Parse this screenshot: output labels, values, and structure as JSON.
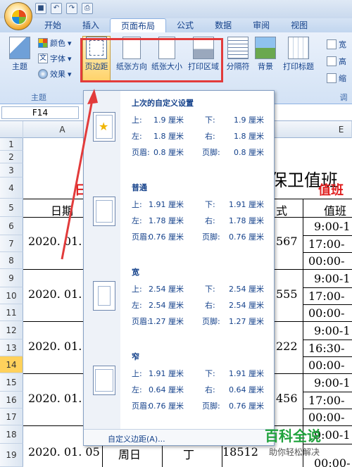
{
  "tabs": [
    "开始",
    "插入",
    "页面布局",
    "公式",
    "数据",
    "审阅",
    "视图"
  ],
  "ribbon": {
    "theme_group": {
      "label": "主题",
      "themes_button": "主题",
      "colors": "颜色",
      "fonts": "字体",
      "effects": "效果"
    },
    "page_setup_buttons": [
      "页边距",
      "纸张方向",
      "纸张大小",
      "打印区域",
      "分隔符",
      "背景",
      "打印标题"
    ],
    "right_items": [
      "宽",
      "高",
      "缩"
    ],
    "right_group_label": "调"
  },
  "formula_bar": {
    "name_box": "F14"
  },
  "columns": [
    "A",
    "E"
  ],
  "rows": [
    "1",
    "2",
    "3",
    "4",
    "5",
    "6",
    "7",
    "8",
    "9",
    "10",
    "11",
    "12",
    "13",
    "14",
    "15",
    "16",
    "17",
    "18",
    "19"
  ],
  "sheet": {
    "title_fragment": "全保卫值班",
    "header_left": "日",
    "header_right": "值班",
    "col_date": "日期",
    "col_shift": "值班",
    "col_partial": "式",
    "dates": [
      "2020. 01.",
      "2020. 01.",
      "2020. 01.",
      "2020. 01.",
      "2020. 01. 05"
    ],
    "phone_fragments": [
      "567",
      "555",
      "222",
      "456",
      "18512"
    ],
    "weekday_fragment": "周日",
    "name_fragment": "丁",
    "times": [
      "9:00-1",
      "17:00-",
      "00:00-",
      "9:00-1",
      "17:00-",
      "00:00-",
      "9:00-1",
      "16:30-",
      "00:00-",
      "9:00-1",
      "17:00-",
      "00:00-",
      "9:00-1",
      "00:00-"
    ]
  },
  "dropdown": {
    "presets": [
      {
        "name": "上次的自定义设置",
        "top": "1.9 厘米",
        "bottom": "1.9 厘米",
        "left": "1.8 厘米",
        "right": "1.8 厘米",
        "header": "0.8 厘米",
        "footer": "0.8 厘米"
      },
      {
        "name": "普通",
        "top": "1.91 厘米",
        "bottom": "1.91 厘米",
        "left": "1.78 厘米",
        "right": "1.78 厘米",
        "header": "0.76 厘米",
        "footer": "0.76 厘米"
      },
      {
        "name": "宽",
        "top": "2.54 厘米",
        "bottom": "2.54 厘米",
        "left": "2.54 厘米",
        "right": "2.54 厘米",
        "header": "1.27 厘米",
        "footer": "1.27 厘米"
      },
      {
        "name": "窄",
        "top": "1.91 厘米",
        "bottom": "1.91 厘米",
        "left": "0.64 厘米",
        "right": "0.64 厘米",
        "header": "0.76 厘米",
        "footer": "0.76 厘米"
      }
    ],
    "labels": {
      "top": "上:",
      "bottom": "下:",
      "left": "左:",
      "right": "右:",
      "header": "页眉:",
      "footer": "页脚:"
    },
    "custom": "自定义边距(A)..."
  },
  "watermark": {
    "title": "百科全说",
    "subtitle": "助你轻松解决"
  },
  "colors": {
    "highlight": "#e23b3b",
    "red_text": "#e02020",
    "ribbon_blue": "#15428b"
  }
}
